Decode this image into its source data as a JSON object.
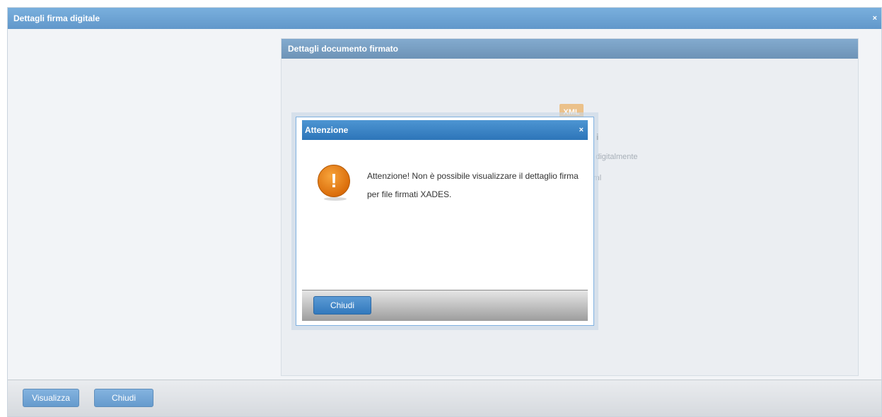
{
  "window": {
    "title": "Dettagli firma digitale",
    "close_glyph": "×"
  },
  "panel": {
    "title": "Dettagli documento firmato",
    "file_icon_label": "XML",
    "partial_text_1": "i",
    "partial_text_2": "to digitalmente",
    "partial_text_3": ".xml"
  },
  "footer": {
    "visualizza_label": "Visualizza",
    "chiudi_label": "Chiudi"
  },
  "modal": {
    "title": "Attenzione",
    "close_glyph": "×",
    "icon_glyph": "!",
    "icon_name": "warning-icon",
    "message": "Attenzione! Non è possibile visualizzare il dettaglio firma per file firmati XADES.",
    "chiudi_label": "Chiudi"
  }
}
